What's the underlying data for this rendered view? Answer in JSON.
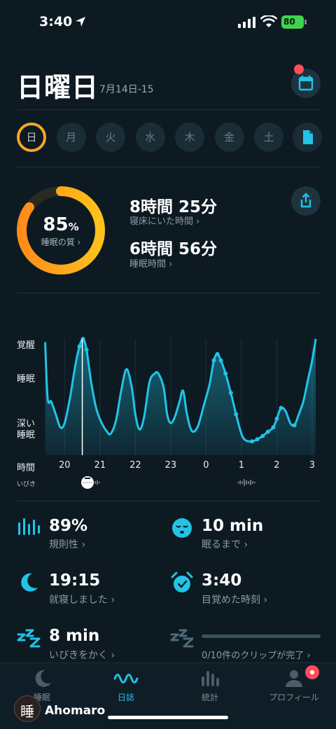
{
  "status_bar": {
    "time": "3:40",
    "battery": "80"
  },
  "header": {
    "day_title": "日曜日",
    "date_range": "7月14日-15"
  },
  "week": [
    {
      "label": "日",
      "active": true
    },
    {
      "label": "月",
      "active": false
    },
    {
      "label": "火",
      "active": false
    },
    {
      "label": "水",
      "active": false
    },
    {
      "label": "木",
      "active": false
    },
    {
      "label": "金",
      "active": false
    },
    {
      "label": "土",
      "active": false
    }
  ],
  "summary": {
    "quality_value": "85",
    "quality_unit": "%",
    "quality_label": "睡眠の質 ›",
    "quality_fraction": 0.85,
    "time_in_bed": "8時間 25分",
    "time_in_bed_label": "寝床にいた時間 ›",
    "sleep_time": "6時間 56分",
    "sleep_time_label": "睡眠時間 ›"
  },
  "chart_data": {
    "type": "area",
    "y_categories": [
      "覚醒",
      "睡眠",
      "深い\n睡眠"
    ],
    "x_ticks": [
      "20",
      "21",
      "22",
      "23",
      "0",
      "1",
      "2",
      "3"
    ],
    "x_axis_label": "時間",
    "snore_label": "いびき",
    "series": [
      {
        "values": [
          [
            19.45,
            0.97
          ],
          [
            19.52,
            0.45
          ],
          [
            19.62,
            0.42
          ],
          [
            19.75,
            0.3
          ],
          [
            19.88,
            0.18
          ],
          [
            20.0,
            0.22
          ],
          [
            20.15,
            0.45
          ],
          [
            20.3,
            0.75
          ],
          [
            20.42,
            0.93
          ],
          [
            20.52,
            1.0
          ],
          [
            20.62,
            0.9
          ],
          [
            20.75,
            0.6
          ],
          [
            20.9,
            0.35
          ],
          [
            21.05,
            0.22
          ],
          [
            21.2,
            0.14
          ],
          [
            21.3,
            0.12
          ],
          [
            21.45,
            0.24
          ],
          [
            21.6,
            0.52
          ],
          [
            21.75,
            0.72
          ],
          [
            21.9,
            0.55
          ],
          [
            22.0,
            0.3
          ],
          [
            22.12,
            0.16
          ],
          [
            22.25,
            0.28
          ],
          [
            22.4,
            0.6
          ],
          [
            22.55,
            0.68
          ],
          [
            22.65,
            0.68
          ],
          [
            22.8,
            0.55
          ],
          [
            22.9,
            0.3
          ],
          [
            23.0,
            0.22
          ],
          [
            23.12,
            0.28
          ],
          [
            23.25,
            0.42
          ],
          [
            23.35,
            0.52
          ],
          [
            23.45,
            0.32
          ],
          [
            23.55,
            0.18
          ],
          [
            23.65,
            0.14
          ],
          [
            23.78,
            0.2
          ],
          [
            23.95,
            0.4
          ],
          [
            24.1,
            0.58
          ],
          [
            24.22,
            0.8
          ],
          [
            24.32,
            0.86
          ],
          [
            24.42,
            0.8
          ],
          [
            24.55,
            0.68
          ],
          [
            24.7,
            0.5
          ],
          [
            24.85,
            0.3
          ],
          [
            25.0,
            0.12
          ],
          [
            25.12,
            0.06
          ],
          [
            25.3,
            0.05
          ],
          [
            25.45,
            0.07
          ],
          [
            25.6,
            0.1
          ],
          [
            25.75,
            0.14
          ],
          [
            25.9,
            0.18
          ],
          [
            26.0,
            0.26
          ],
          [
            26.12,
            0.36
          ],
          [
            26.25,
            0.33
          ],
          [
            26.38,
            0.22
          ],
          [
            26.5,
            0.2
          ],
          [
            26.62,
            0.3
          ],
          [
            26.75,
            0.42
          ],
          [
            26.88,
            0.62
          ],
          [
            27.0,
            0.8
          ],
          [
            27.1,
            1.0
          ]
        ]
      }
    ],
    "xlim": [
      19.4,
      27.12
    ],
    "ylim": [
      0,
      1
    ],
    "current_time": 20.5
  },
  "metrics": [
    {
      "value": "89%",
      "label": "規則性 ›",
      "icon": "bars-icon"
    },
    {
      "value": "10 min",
      "label": "眠るまで ›",
      "icon": "sleepy-face-icon"
    },
    {
      "value": "19:15",
      "label": "就寝しました ›",
      "icon": "moon-icon"
    },
    {
      "value": "3:40",
      "label": "目覚めた時刻 ›",
      "icon": "alarm-clock-icon"
    },
    {
      "value": "8 min",
      "label": "いびきをかく ›",
      "icon": "snore-zzz-icon"
    },
    {
      "value": "",
      "label": "0/10件のクリップが完了 ›",
      "icon": "snore-zzz-dim-icon"
    }
  ],
  "tabs": [
    {
      "label": "睡眠",
      "active": false
    },
    {
      "label": "日誌",
      "active": true
    },
    {
      "label": "統計",
      "active": false
    },
    {
      "label": "プロフィール",
      "active": false
    }
  ],
  "watermark": {
    "text": "Ahomaro",
    "seal_char": "睡"
  },
  "colors": {
    "accent": "#22c3e6",
    "ring": "#f5a623",
    "background": "#0d1a22",
    "badge": "#ff4d5e"
  }
}
